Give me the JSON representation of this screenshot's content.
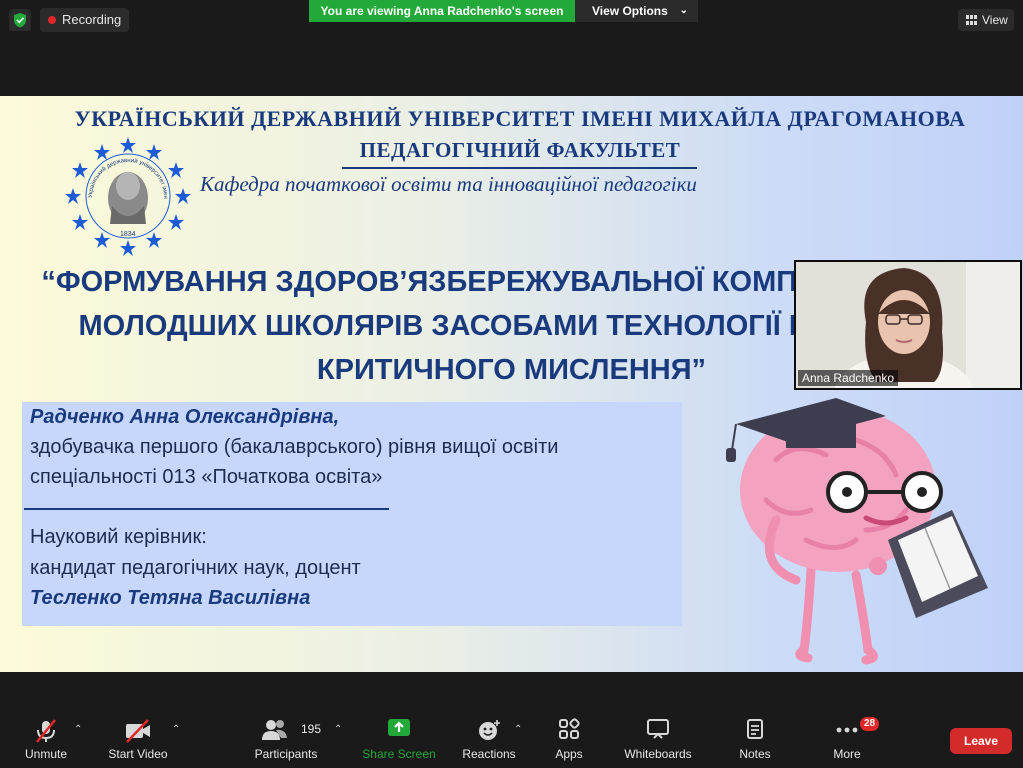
{
  "top_bar": {
    "recording_label": "Recording",
    "viewing_banner": "You are viewing Anna Radchenko's screen",
    "view_options_label": "View Options",
    "view_label": "View"
  },
  "slide": {
    "university": "УКРАЇНСЬКИЙ ДЕРЖАВНИЙ УНІВЕРСИТЕТ ІМЕНІ МИХАЙЛА ДРАГОМАНОВА",
    "faculty": "ПЕДАГОГІЧНИЙ ФАКУЛЬТЕТ",
    "department": "Кафедра початкової освіти та інноваційної педагогіки",
    "logo_text": "Український державний університет імені Михайла Драгоманова",
    "logo_year": "1834",
    "topic_line1": "“ФОРМУВАННЯ ЗДОРОВ’ЯЗБЕРЕЖУВАЛЬНОЇ КОМПЕТЕНТНОСТІ",
    "topic_line2": "МОЛОДШИХ ШКОЛЯРІВ ЗАСОБАМИ ТЕХНОЛОГІЇ РОЗВИТКУ",
    "topic_line3": "КРИТИЧНОГО МИСЛЕННЯ”",
    "author_name": "Радченко Анна Олександрівна,",
    "author_line1": "здобувачка першого (бакалаврського) рівня вищої освіти",
    "author_line2": "спеціальності 013 «Початкова освіта»",
    "supervisor_label": "Науковий керівник:",
    "supervisor_degree": "кандидат педагогічних наук, доцент",
    "supervisor_name": "Тесленко Тетяна Василівна"
  },
  "video_tile": {
    "participant_name": "Anna Radchenko"
  },
  "toolbar": {
    "unmute_label": "Unmute",
    "start_video_label": "Start Video",
    "participants_label": "Participants",
    "participants_count": "195",
    "share_screen_label": "Share Screen",
    "reactions_label": "Reactions",
    "apps_label": "Apps",
    "whiteboards_label": "Whiteboards",
    "notes_label": "Notes",
    "more_label": "More",
    "more_badge": "28",
    "leave_label": "Leave"
  },
  "colors": {
    "share_green": "#23a83a",
    "leave_red": "#d32a2a",
    "slide_navy": "#1a3a7e",
    "info_box_blue": "#c6d7fb"
  }
}
